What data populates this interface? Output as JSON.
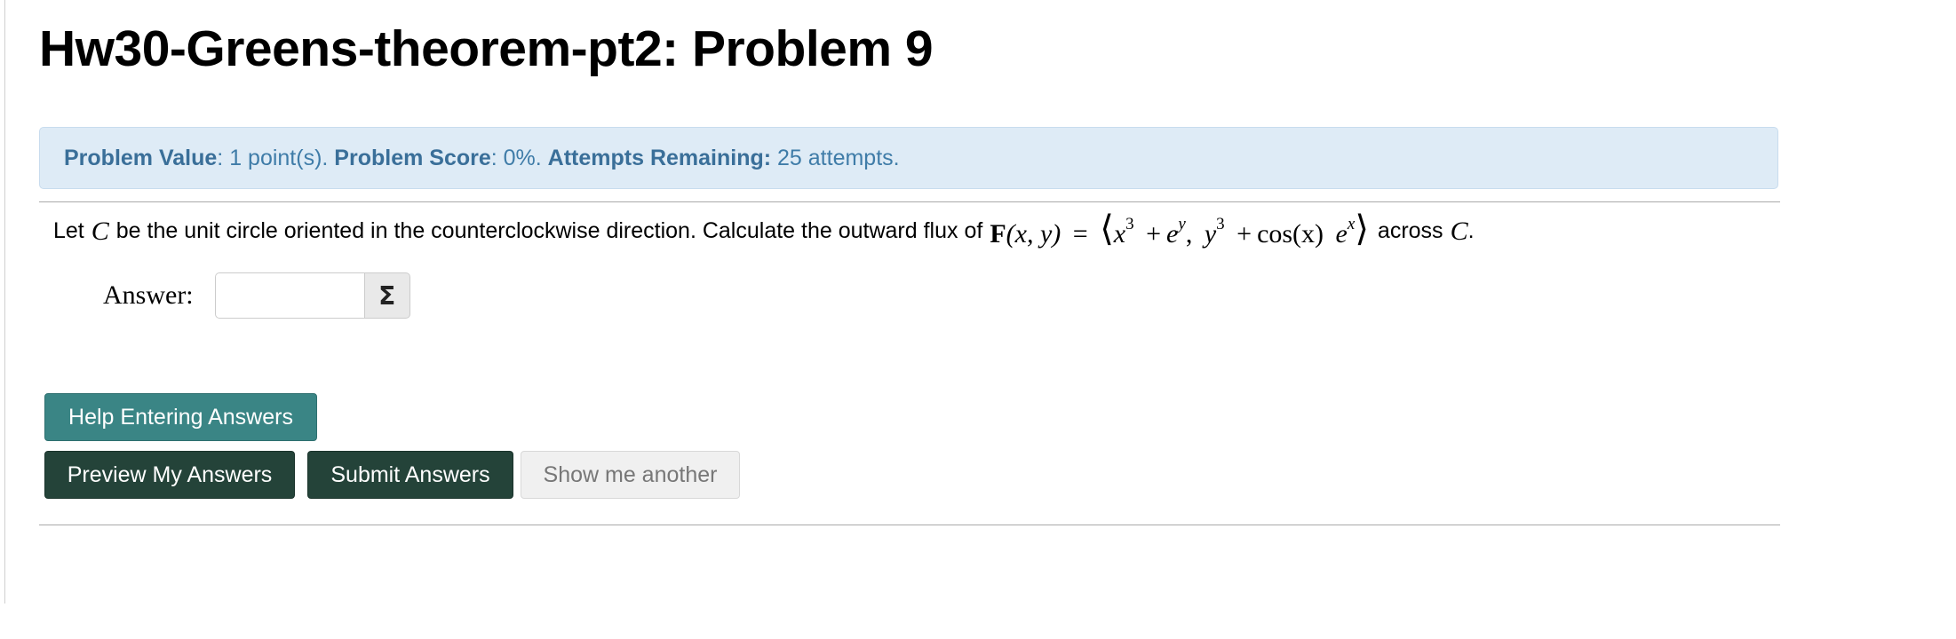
{
  "page": {
    "title": "Hw30-Greens-theorem-pt2: Problem 9"
  },
  "info": {
    "value_label": "Problem Value",
    "value_text": ": 1 point(s). ",
    "score_label": "Problem Score",
    "score_text": ": 0%. ",
    "attempts_label": "Attempts Remaining:",
    "attempts_text": " 25 attempts."
  },
  "problem": {
    "text_let": "Let",
    "var_C": "C",
    "text_middle": "be the unit circle oriented in the counterclockwise direction. Calculate the outward flux of",
    "field_F": "F",
    "field_args": "(x, y)",
    "equals": "=",
    "comp1_base": "x",
    "comp1_exp": "3",
    "comp1_plus": "+",
    "comp1_e": "e",
    "comp1_eexp": "y",
    "comma": ",",
    "comp2_base": "y",
    "comp2_exp": "3",
    "comp2_plus": "+",
    "comp2_cos": "cos(x)",
    "comp2_e": "e",
    "comp2_eexp": "x",
    "text_across": "across",
    "var_C2": "C",
    "period": "."
  },
  "answer": {
    "label": "Answer:",
    "value": "",
    "placeholder": "",
    "equation_button_icon": "sigma-icon",
    "equation_button_glyph": "Σ"
  },
  "buttons": {
    "help": "Help Entering Answers",
    "preview": "Preview My Answers",
    "submit": "Submit Answers",
    "another": "Show me another"
  },
  "colors": {
    "info_bg": "#deebf6",
    "info_text": "#3f7ca8",
    "help_button": "#3a8585",
    "dark_button": "#244339",
    "disabled_button": "#f0f0f0"
  }
}
